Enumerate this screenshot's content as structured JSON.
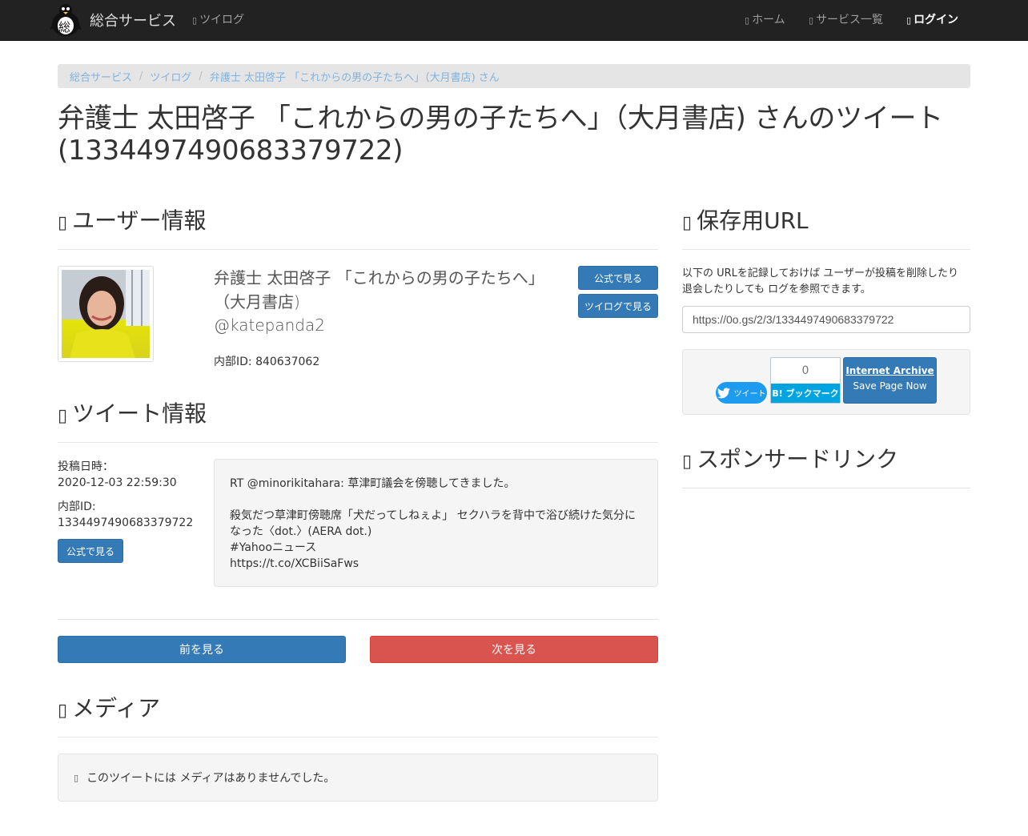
{
  "nav": {
    "brand": "総合サービス",
    "logo_char": "総",
    "twilog": "ツイログ",
    "home": "ホーム",
    "services": "サービス一覧",
    "login": "ログイン"
  },
  "breadcrumb": [
    "総合サービス",
    "ツイログ",
    "弁護士 太田啓子 「これからの男の子たちへ」（大月書店) さん"
  ],
  "page_title": "弁護士 太田啓子 「これからの男の子たちへ」（大月書店) さんのツイート (1334497490683379722)",
  "user_section": {
    "heading": "ユーザー情報",
    "name": "弁護士 太田啓子 「これからの男の子たちへ」（大月書店)",
    "screen_name": "@katepanda2",
    "internal_id": "内部ID: 840637062",
    "official_button": "公式で見る",
    "twilog_button": "ツイログで見る"
  },
  "tweet_section": {
    "heading": "ツイート情報",
    "posted_label": "投稿日時：",
    "posted_value": "2020-12-03 22:59:30",
    "id_label": "内部ID:",
    "id_value": "1334497490683379722",
    "official_button": "公式で見る",
    "lines": [
      "RT @minorikitahara: 草津町議会を傍聴してきました。",
      "",
      "殺気だつ草津町傍聴席「犬だってしねぇよ」 セクハラを背中で浴び続けた気分に",
      "なった〈dot.〉(AERA dot.)",
      "#Yahooニュース",
      "https://t.co/XCBiiSaFws"
    ]
  },
  "pager": {
    "prev": "前を見る",
    "next": "次を見る"
  },
  "media_section": {
    "heading": "メディア",
    "empty_text": "このツイートには メディアはありませんでした。"
  },
  "save_section": {
    "heading": "保存用URL",
    "description": "以下の URLを記録しておけば ユーザーが投稿を削除したり 退会したりしても ログを参照できます。",
    "url": "https://0o.gs/2/3/1334497490683379722",
    "tweet_button": "ツイート",
    "hatena_count": "0",
    "hatena_button": "B! ブックマーク",
    "ia_title": "Internet Archive",
    "ia_sub": "Save Page Now"
  },
  "sponsor_section": {
    "heading": "スポンサードリンク"
  },
  "colors": {
    "navbar": "#222222",
    "primary": "#337ab7",
    "danger": "#d9534f",
    "hatena": "#00a4de",
    "twitter": "#1d9bf0"
  }
}
